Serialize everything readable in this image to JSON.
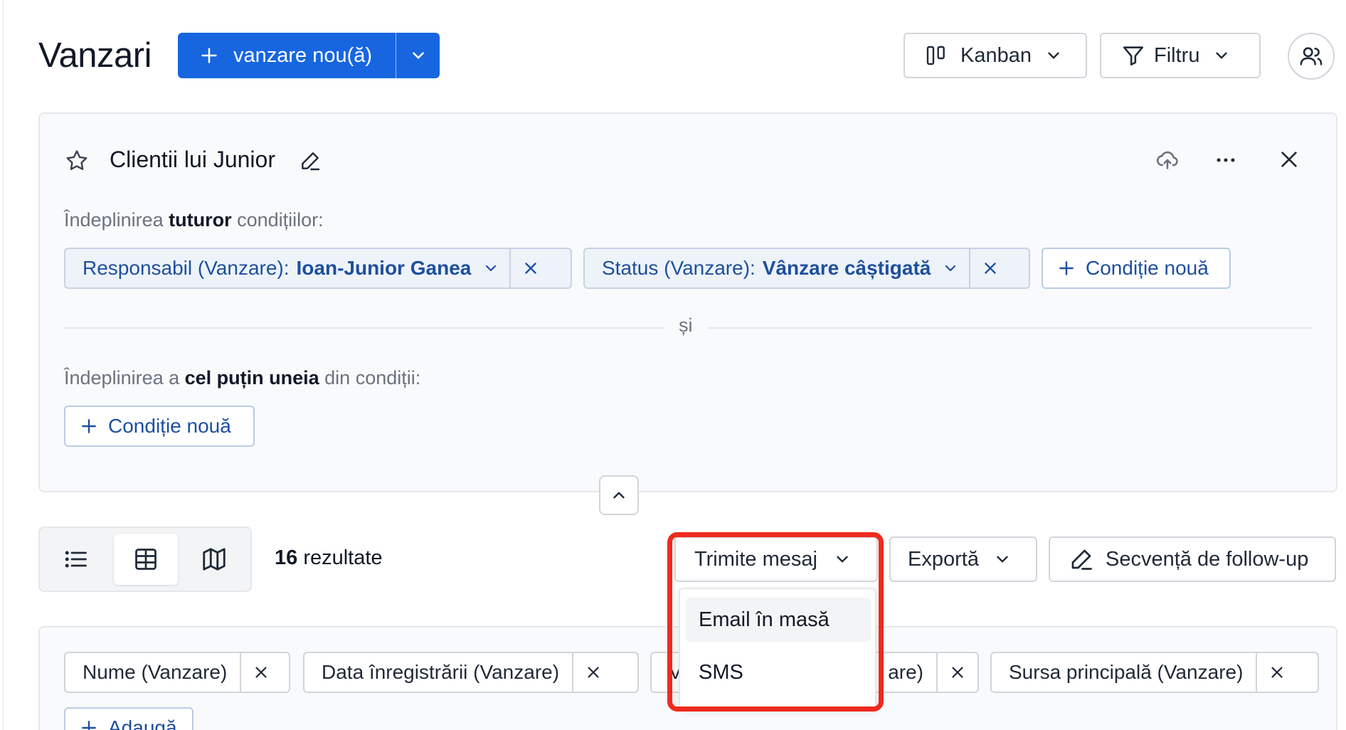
{
  "header": {
    "title": "Vanzari",
    "new_button_label": "vanzare nou(ă)",
    "kanban_label": "Kanban",
    "filter_label": "Filtru"
  },
  "filter": {
    "name": "Clientii lui Junior",
    "all_prefix": "Îndeplinirea ",
    "all_bold": "tuturor",
    "all_suffix": " condițiilor:",
    "conditions": [
      {
        "field": "Responsabil (Vanzare):",
        "value": "Ioan-Junior Ganea"
      },
      {
        "field": "Status (Vanzare):",
        "value": "Vânzare câștigată"
      }
    ],
    "add_condition": "Condiție nouă",
    "divider": "și",
    "any_prefix": "Îndeplinirea a ",
    "any_bold": "cel puțin uneia",
    "any_suffix": " din condiții:"
  },
  "toolbar": {
    "results_count": "16",
    "results_label": " rezultate",
    "send_message": "Trimite mesaj",
    "export": "Exportă",
    "sequence": "Secvență de follow-up"
  },
  "message_menu": {
    "items": [
      "Email în masă",
      "SMS"
    ]
  },
  "columns": {
    "chips": [
      "Nume (Vanzare)",
      "Data înregistrării (Vanzare)",
      "Ve",
      "are)",
      "Sursa principală (Vanzare)"
    ],
    "add": "Adaugă"
  },
  "colors": {
    "primary": "#1766e0",
    "chip_text": "#1d4f9e",
    "highlight": "#ef2a1d"
  }
}
